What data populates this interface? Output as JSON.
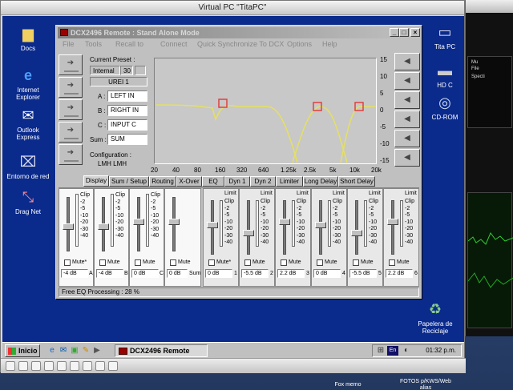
{
  "host": {
    "title": "Virtual PC \"TitaPC\"",
    "dock": {
      "item1": "Fox memo",
      "item2_line1": "FOTOS p/KWS/Web",
      "item2_line2": "alias"
    }
  },
  "right_window": {
    "labels": [
      "Mu",
      "File",
      "Specti"
    ]
  },
  "desktop_icons": {
    "docs": "Docs",
    "ie_l1": "Internet",
    "ie_l2": "Explorer",
    "outlook_l1": "Outlook",
    "outlook_l2": "Express",
    "network": "Entorno de red",
    "dragnet": "Drag Net",
    "titapc": "Tita PC",
    "hdc": "HD C",
    "cdrom": "CD-ROM",
    "recycle_l1": "Papelera de",
    "recycle_l2": "Reciclaje"
  },
  "taskbar": {
    "start": "Inicio",
    "task": "DCX2496 Remote",
    "lang": "En",
    "clock": "01:32 p.m."
  },
  "dcx": {
    "title": "DCX2496 Remote : Stand Alone Mode",
    "menu": [
      "File",
      "Tools",
      "Recall to",
      "Connect",
      "Quick Synchronize To DCX",
      "Options",
      "Help"
    ],
    "current_preset_label": "Current Preset :",
    "preset_source": "Internal",
    "preset_number": "30",
    "preset_name": "UREI 1",
    "inputs": [
      {
        "key": "A :",
        "name": "LEFT IN"
      },
      {
        "key": "B :",
        "name": "RIGHT IN"
      },
      {
        "key": "C :",
        "name": "INPUT C"
      },
      {
        "key": "Sum :",
        "name": "SUM"
      }
    ],
    "configuration_label": "Configuration :",
    "configuration_value": "LMH LMH",
    "db_ticks": [
      "15",
      "10",
      "5",
      "0",
      "-5",
      "-10",
      "-15"
    ],
    "freq_ticks": [
      "20",
      "40",
      "80",
      "160",
      "320",
      "640",
      "1.25k",
      "2.5k",
      "5k",
      "10k",
      "20k"
    ],
    "tabs": [
      "Display",
      "Sum / Setup",
      "Routing",
      "X-Over",
      "EQ",
      "Dyn 1",
      "Dyn 2",
      "Limiter",
      "Long Delay",
      "Short Delay"
    ],
    "meter_scale": [
      "Clip",
      "-2",
      "-5",
      "-10",
      "-20",
      "-30",
      "-40"
    ],
    "limit_label": "Limit",
    "mute_label": "Mute",
    "mute_star_label": "Mute*",
    "input_strips": [
      {
        "gain": "-4 dB",
        "ch": "A",
        "fader": 0.55,
        "mute": "Mute*"
      },
      {
        "gain": "-4 dB",
        "ch": "B",
        "fader": 0.55,
        "mute": "Mute"
      },
      {
        "gain": "0 dB",
        "ch": "C",
        "fader": 0.45,
        "mute": "Mute"
      },
      {
        "gain": "0 dB",
        "ch": "Sum",
        "fader": 0.45,
        "mute": "Mute"
      }
    ],
    "output_strips": [
      {
        "gain": "0 dB",
        "ch": "1",
        "fader": 0.45,
        "mute": "Mute*"
      },
      {
        "gain": "-5.5 dB",
        "ch": "2",
        "fader": 0.62,
        "mute": "Mute"
      },
      {
        "gain": "2.2 dB",
        "ch": "3",
        "fader": 0.38,
        "mute": "Mute"
      },
      {
        "gain": "0 dB",
        "ch": "4",
        "fader": 0.45,
        "mute": "Mute"
      },
      {
        "gain": "-5.5 dB",
        "ch": "5",
        "fader": 0.62,
        "mute": "Mute"
      },
      {
        "gain": "2.2 dB",
        "ch": "6",
        "fader": 0.38,
        "mute": "Mute"
      }
    ],
    "status": "Free EQ Processing :  28 %"
  },
  "colors": {
    "desktop": "#0a2a8c",
    "curve": "#e6e060",
    "marker": "#e04040"
  }
}
